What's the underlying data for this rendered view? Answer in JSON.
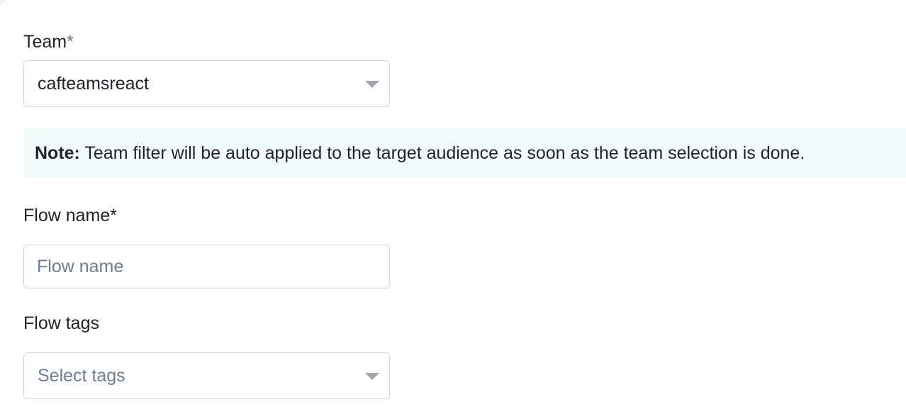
{
  "form": {
    "team": {
      "label": "Team",
      "required_mark": "*",
      "selected_value": "cafteamsreact"
    },
    "note": {
      "prefix": "Note:",
      "text": " Team filter will be auto applied to the target audience as soon as the team selection is done."
    },
    "flow_name": {
      "label": "Flow name",
      "required_mark": "*",
      "placeholder": "Flow name"
    },
    "flow_tags": {
      "label": "Flow tags",
      "placeholder": "Select tags"
    }
  },
  "icons": {
    "team_dropdown": "chevron-down-icon",
    "tags_dropdown": "chevron-down-icon"
  },
  "colors": {
    "note_background": "#f1fbf9",
    "field_border": "#cfd6e1",
    "placeholder": "#6e7b91"
  }
}
